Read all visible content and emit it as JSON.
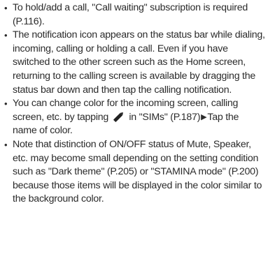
{
  "notes": [
    {
      "text": "To hold/add a call, \"Call waiting\" subscription is required (P.116)."
    },
    {
      "text": "The notification icon appears on the status bar while dialing, incoming, calling or holding a call. Even if you have switched to the other screen such as the Home screen, returning to the calling screen is available by dragging the status bar down and then tap the calling notification."
    },
    {
      "before": "You can change color for the incoming screen, calling screen, etc. by tapping",
      "icon": "pencil-icon",
      "middle": "in \"SIMs\" (P.187)",
      "arrow": "right-arrow-icon",
      "after": "Tap the name of color."
    },
    {
      "text": "Note that distinction of ON/OFF status of Mute, Speaker, etc. may become small depending on the setting condition such as \"Dark theme\" (P.205) or \"STAMINA mode\" (P.200) because those items will be displayed in the color similar to the background color."
    }
  ]
}
